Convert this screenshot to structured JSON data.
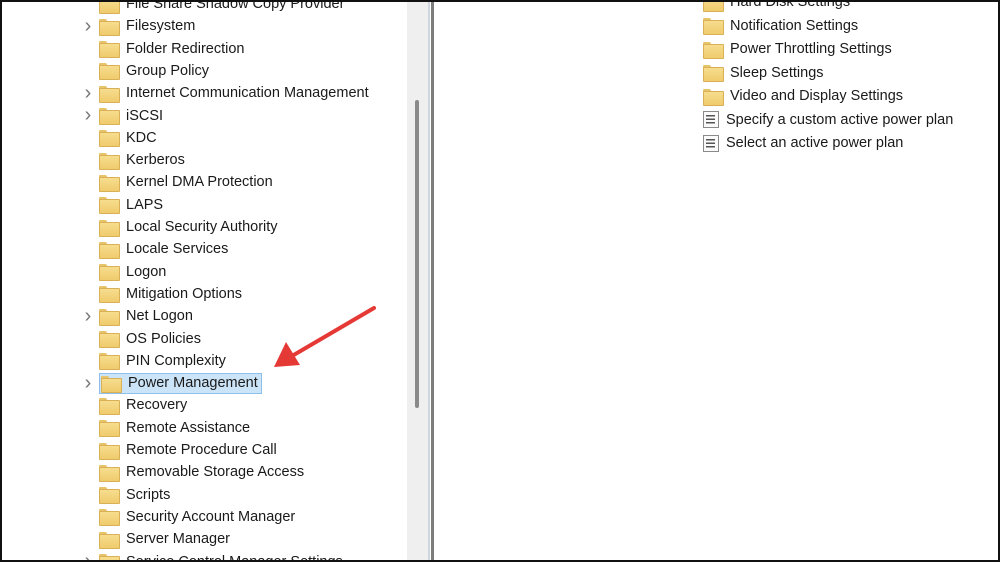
{
  "tree": {
    "items": [
      {
        "label": "File Share Shadow Copy Provider",
        "expandable": false
      },
      {
        "label": "Filesystem",
        "expandable": true
      },
      {
        "label": "Folder Redirection",
        "expandable": false
      },
      {
        "label": "Group Policy",
        "expandable": false
      },
      {
        "label": "Internet Communication Management",
        "expandable": true
      },
      {
        "label": "iSCSI",
        "expandable": true
      },
      {
        "label": "KDC",
        "expandable": false
      },
      {
        "label": "Kerberos",
        "expandable": false
      },
      {
        "label": "Kernel DMA Protection",
        "expandable": false
      },
      {
        "label": "LAPS",
        "expandable": false
      },
      {
        "label": "Local Security Authority",
        "expandable": false
      },
      {
        "label": "Locale Services",
        "expandable": false
      },
      {
        "label": "Logon",
        "expandable": false
      },
      {
        "label": "Mitigation Options",
        "expandable": false
      },
      {
        "label": "Net Logon",
        "expandable": true
      },
      {
        "label": "OS Policies",
        "expandable": false
      },
      {
        "label": "PIN Complexity",
        "expandable": false
      },
      {
        "label": "Power Management",
        "expandable": true,
        "selected": true
      },
      {
        "label": "Recovery",
        "expandable": false
      },
      {
        "label": "Remote Assistance",
        "expandable": false
      },
      {
        "label": "Remote Procedure Call",
        "expandable": false
      },
      {
        "label": "Removable Storage Access",
        "expandable": false
      },
      {
        "label": "Scripts",
        "expandable": false
      },
      {
        "label": "Security Account Manager",
        "expandable": false
      },
      {
        "label": "Server Manager",
        "expandable": false
      },
      {
        "label": "Service Control Manager Settings",
        "expandable": true
      }
    ]
  },
  "details": {
    "items": [
      {
        "label": "Hard Disk Settings",
        "type": "folder"
      },
      {
        "label": "Notification Settings",
        "type": "folder"
      },
      {
        "label": "Power Throttling Settings",
        "type": "folder"
      },
      {
        "label": "Sleep Settings",
        "type": "folder"
      },
      {
        "label": "Video and Display Settings",
        "type": "folder"
      },
      {
        "label": "Specify a custom active power plan",
        "type": "policy"
      },
      {
        "label": "Select an active power plan",
        "type": "policy"
      }
    ]
  },
  "annotation": {
    "color": "#e53935"
  }
}
